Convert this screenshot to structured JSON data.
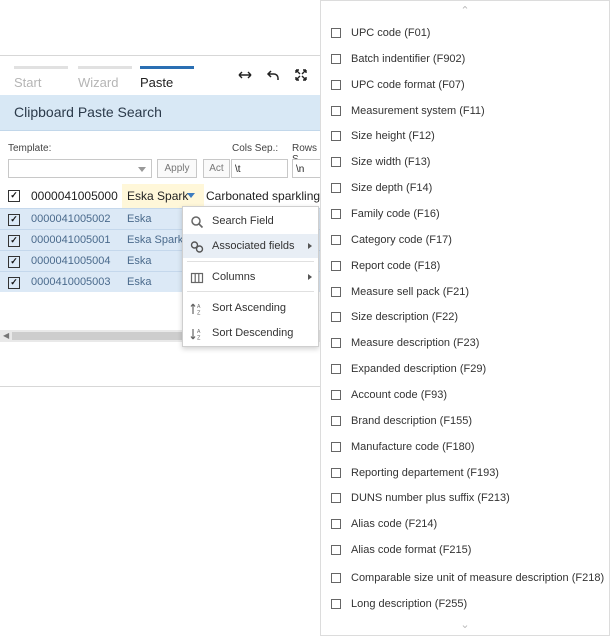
{
  "tabs": [
    {
      "label": "Start"
    },
    {
      "label": "Wizard"
    },
    {
      "label": "Paste"
    }
  ],
  "icons": {
    "expand_h": "arrows-horizontal-icon",
    "undo": "undo-arrow-icon",
    "fullscreen": "fullscreen-icon"
  },
  "panel": {
    "title": "Clipboard Paste Search",
    "template_label": "Template:",
    "cols_sep_label": "Cols Sep.:",
    "rows_sep_label": "Rows S",
    "apply_label": "Apply",
    "act_label": "Act",
    "cols_sep_value": "\\t",
    "rows_sep_value": "\\n",
    "template_value": ""
  },
  "grid": {
    "header": {
      "code": "0000041005000",
      "brand": "Eska Spark",
      "desc": "Carbonated sparkling"
    },
    "rows": [
      {
        "code": "0000041005002",
        "brand": "Eska"
      },
      {
        "code": "0000041005001",
        "brand": "Eska Spark"
      },
      {
        "code": "0000041005004",
        "brand": "Eska"
      },
      {
        "code": "0000410005003",
        "brand": "Eska"
      }
    ]
  },
  "context_menu": {
    "items": [
      {
        "label": "Search Field",
        "icon": "search-icon"
      },
      {
        "label": "Associated fields",
        "icon": "link-icon",
        "has_submenu": true,
        "active": true
      },
      {
        "label": "Columns",
        "icon": "columns-icon",
        "has_submenu": true
      },
      {
        "label": "Sort Ascending",
        "icon": "sort-ascending-icon"
      },
      {
        "label": "Sort Descending",
        "icon": "sort-descending-icon"
      }
    ]
  },
  "associated_fields": [
    "UPC code (F01)",
    "Batch indentifier (F902)",
    "UPC code format (F07)",
    "Measurement system (F11)",
    "Size height (F12)",
    "Size width (F13)",
    "Size depth (F14)",
    "Family code (F16)",
    "Category code (F17)",
    "Report code (F18)",
    "Measure sell pack (F21)",
    "Size description (F22)",
    "Measure description (F23)",
    "Expanded description (F29)",
    "Account code (F93)",
    "Brand description (F155)",
    "Manufacture code (F180)",
    "Reporting departement (F193)",
    "DUNS number plus suffix (F213)",
    "Alias code (F214)",
    "Alias code format (F215)",
    "Comparable size unit of measure description (F218)",
    "Long description (F255)"
  ]
}
